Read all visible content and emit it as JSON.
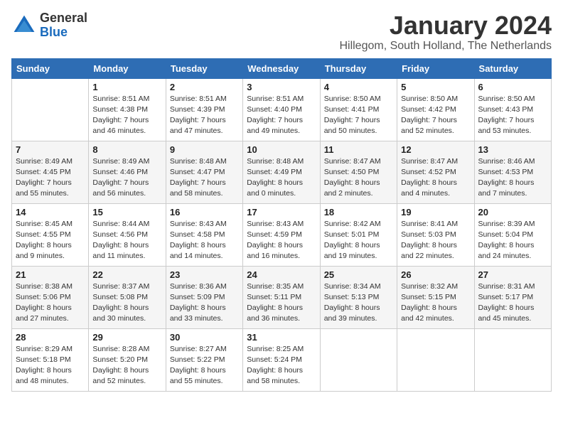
{
  "logo": {
    "general": "General",
    "blue": "Blue"
  },
  "header": {
    "month": "January 2024",
    "location": "Hillegom, South Holland, The Netherlands"
  },
  "weekdays": [
    "Sunday",
    "Monday",
    "Tuesday",
    "Wednesday",
    "Thursday",
    "Friday",
    "Saturday"
  ],
  "weeks": [
    [
      {
        "day": "",
        "sunrise": "",
        "sunset": "",
        "daylight": ""
      },
      {
        "day": "1",
        "sunrise": "Sunrise: 8:51 AM",
        "sunset": "Sunset: 4:38 PM",
        "daylight": "Daylight: 7 hours and 46 minutes."
      },
      {
        "day": "2",
        "sunrise": "Sunrise: 8:51 AM",
        "sunset": "Sunset: 4:39 PM",
        "daylight": "Daylight: 7 hours and 47 minutes."
      },
      {
        "day": "3",
        "sunrise": "Sunrise: 8:51 AM",
        "sunset": "Sunset: 4:40 PM",
        "daylight": "Daylight: 7 hours and 49 minutes."
      },
      {
        "day": "4",
        "sunrise": "Sunrise: 8:50 AM",
        "sunset": "Sunset: 4:41 PM",
        "daylight": "Daylight: 7 hours and 50 minutes."
      },
      {
        "day": "5",
        "sunrise": "Sunrise: 8:50 AM",
        "sunset": "Sunset: 4:42 PM",
        "daylight": "Daylight: 7 hours and 52 minutes."
      },
      {
        "day": "6",
        "sunrise": "Sunrise: 8:50 AM",
        "sunset": "Sunset: 4:43 PM",
        "daylight": "Daylight: 7 hours and 53 minutes."
      }
    ],
    [
      {
        "day": "7",
        "sunrise": "Sunrise: 8:49 AM",
        "sunset": "Sunset: 4:45 PM",
        "daylight": "Daylight: 7 hours and 55 minutes."
      },
      {
        "day": "8",
        "sunrise": "Sunrise: 8:49 AM",
        "sunset": "Sunset: 4:46 PM",
        "daylight": "Daylight: 7 hours and 56 minutes."
      },
      {
        "day": "9",
        "sunrise": "Sunrise: 8:48 AM",
        "sunset": "Sunset: 4:47 PM",
        "daylight": "Daylight: 7 hours and 58 minutes."
      },
      {
        "day": "10",
        "sunrise": "Sunrise: 8:48 AM",
        "sunset": "Sunset: 4:49 PM",
        "daylight": "Daylight: 8 hours and 0 minutes."
      },
      {
        "day": "11",
        "sunrise": "Sunrise: 8:47 AM",
        "sunset": "Sunset: 4:50 PM",
        "daylight": "Daylight: 8 hours and 2 minutes."
      },
      {
        "day": "12",
        "sunrise": "Sunrise: 8:47 AM",
        "sunset": "Sunset: 4:52 PM",
        "daylight": "Daylight: 8 hours and 4 minutes."
      },
      {
        "day": "13",
        "sunrise": "Sunrise: 8:46 AM",
        "sunset": "Sunset: 4:53 PM",
        "daylight": "Daylight: 8 hours and 7 minutes."
      }
    ],
    [
      {
        "day": "14",
        "sunrise": "Sunrise: 8:45 AM",
        "sunset": "Sunset: 4:55 PM",
        "daylight": "Daylight: 8 hours and 9 minutes."
      },
      {
        "day": "15",
        "sunrise": "Sunrise: 8:44 AM",
        "sunset": "Sunset: 4:56 PM",
        "daylight": "Daylight: 8 hours and 11 minutes."
      },
      {
        "day": "16",
        "sunrise": "Sunrise: 8:43 AM",
        "sunset": "Sunset: 4:58 PM",
        "daylight": "Daylight: 8 hours and 14 minutes."
      },
      {
        "day": "17",
        "sunrise": "Sunrise: 8:43 AM",
        "sunset": "Sunset: 4:59 PM",
        "daylight": "Daylight: 8 hours and 16 minutes."
      },
      {
        "day": "18",
        "sunrise": "Sunrise: 8:42 AM",
        "sunset": "Sunset: 5:01 PM",
        "daylight": "Daylight: 8 hours and 19 minutes."
      },
      {
        "day": "19",
        "sunrise": "Sunrise: 8:41 AM",
        "sunset": "Sunset: 5:03 PM",
        "daylight": "Daylight: 8 hours and 22 minutes."
      },
      {
        "day": "20",
        "sunrise": "Sunrise: 8:39 AM",
        "sunset": "Sunset: 5:04 PM",
        "daylight": "Daylight: 8 hours and 24 minutes."
      }
    ],
    [
      {
        "day": "21",
        "sunrise": "Sunrise: 8:38 AM",
        "sunset": "Sunset: 5:06 PM",
        "daylight": "Daylight: 8 hours and 27 minutes."
      },
      {
        "day": "22",
        "sunrise": "Sunrise: 8:37 AM",
        "sunset": "Sunset: 5:08 PM",
        "daylight": "Daylight: 8 hours and 30 minutes."
      },
      {
        "day": "23",
        "sunrise": "Sunrise: 8:36 AM",
        "sunset": "Sunset: 5:09 PM",
        "daylight": "Daylight: 8 hours and 33 minutes."
      },
      {
        "day": "24",
        "sunrise": "Sunrise: 8:35 AM",
        "sunset": "Sunset: 5:11 PM",
        "daylight": "Daylight: 8 hours and 36 minutes."
      },
      {
        "day": "25",
        "sunrise": "Sunrise: 8:34 AM",
        "sunset": "Sunset: 5:13 PM",
        "daylight": "Daylight: 8 hours and 39 minutes."
      },
      {
        "day": "26",
        "sunrise": "Sunrise: 8:32 AM",
        "sunset": "Sunset: 5:15 PM",
        "daylight": "Daylight: 8 hours and 42 minutes."
      },
      {
        "day": "27",
        "sunrise": "Sunrise: 8:31 AM",
        "sunset": "Sunset: 5:17 PM",
        "daylight": "Daylight: 8 hours and 45 minutes."
      }
    ],
    [
      {
        "day": "28",
        "sunrise": "Sunrise: 8:29 AM",
        "sunset": "Sunset: 5:18 PM",
        "daylight": "Daylight: 8 hours and 48 minutes."
      },
      {
        "day": "29",
        "sunrise": "Sunrise: 8:28 AM",
        "sunset": "Sunset: 5:20 PM",
        "daylight": "Daylight: 8 hours and 52 minutes."
      },
      {
        "day": "30",
        "sunrise": "Sunrise: 8:27 AM",
        "sunset": "Sunset: 5:22 PM",
        "daylight": "Daylight: 8 hours and 55 minutes."
      },
      {
        "day": "31",
        "sunrise": "Sunrise: 8:25 AM",
        "sunset": "Sunset: 5:24 PM",
        "daylight": "Daylight: 8 hours and 58 minutes."
      },
      {
        "day": "",
        "sunrise": "",
        "sunset": "",
        "daylight": ""
      },
      {
        "day": "",
        "sunrise": "",
        "sunset": "",
        "daylight": ""
      },
      {
        "day": "",
        "sunrise": "",
        "sunset": "",
        "daylight": ""
      }
    ]
  ]
}
